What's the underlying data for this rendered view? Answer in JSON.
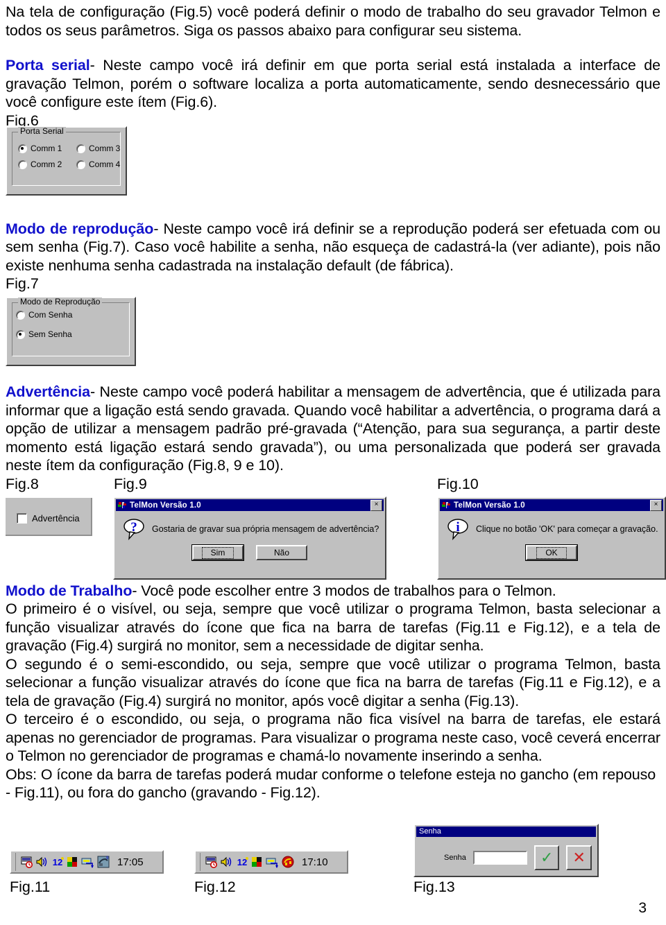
{
  "document": {
    "page_number": "3",
    "intro": "Na tela de configuração (Fig.5) você poderá definir o modo de trabalho do seu gravador Telmon e todos os seus parâmetros. Siga os passos abaixo para configurar seu sistema."
  },
  "sections": {
    "porta_serial": {
      "heading": "Porta serial",
      "body": "- Neste campo você irá definir em que porta serial está instalada a interface de gravação Telmon, porém o software localiza a porta automaticamente, sendo desnecessário que você configure este ítem (Fig.6).",
      "fig_label": "Fig.6"
    },
    "modo_reproducao": {
      "heading": "Modo de reprodução",
      "body": "- Neste campo você irá definir se a reprodução poderá ser efetuada com ou sem senha (Fig.7). Caso você habilite a senha, não esqueça de cadastrá-la (ver adiante), pois não existe nenhuma senha cadastrada na instalação default (de fábrica).",
      "fig_label": "Fig.7"
    },
    "advertencia": {
      "heading": "Advertência",
      "body": "- Neste campo você poderá habilitar a mensagem de advertência, que é utilizada para informar que a ligação está sendo gravada. Quando você habilitar a advertência, o programa dará a opção de utilizar a mensagem padrão pré-gravada (“Atenção, para sua segurança, a partir deste momento está ligação estará sendo gravada”), ou uma personalizada que poderá ser gravada neste ítem da configuração (Fig.8, 9 e 10).",
      "fig_label_8": "Fig.8",
      "fig_label_9": "Fig.9",
      "fig_label_10": "Fig.10"
    },
    "modo_trabalho": {
      "heading": "Modo de Trabalho",
      "body_intro": "- Você pode escolher entre 3 modos de trabalhos para o Telmon.",
      "paragraph_1": "O primeiro é o visível, ou seja, sempre que você utilizar o programa Telmon, basta selecionar a função visualizar através do ícone que fica na barra de tarefas (Fig.11 e Fig.12), e a tela de gravação (Fig.4) surgirá no monitor, sem a necessidade de digitar senha.",
      "paragraph_2": "O segundo é o semi-escondido, ou seja, sempre que você utilizar o programa Telmon, basta selecionar a função visualizar através do ícone que fica na barra de tarefas (Fig.11 e Fig.12), e a tela de gravação (Fig.4) surgirá no monitor, após você digitar a senha (Fig.13).",
      "paragraph_3": "O terceiro é o escondido, ou seja, o programa não fica visível na barra de tarefas, ele estará apenas no gerenciador de programas. Para visualizar o programa neste caso, você ceverá encerrar o Telmon no gerenciador de programas e chamá-lo novamente inserindo a senha.",
      "paragraph_4": "Obs: O ícone da barra de tarefas poderá mudar conforme o telefone esteja no gancho (em repouso - Fig.11), ou fora do gancho (gravando - Fig.12).",
      "fig_label_11": "Fig.11",
      "fig_label_12": "Fig.12",
      "fig_label_13": "Fig.13"
    }
  },
  "figures": {
    "fig6": {
      "group_title": "Porta Serial",
      "options": [
        {
          "label": "Comm 1",
          "selected": true
        },
        {
          "label": "Comm 3",
          "selected": false
        },
        {
          "label": "Comm 2",
          "selected": false
        },
        {
          "label": "Comm 4",
          "selected": false
        }
      ]
    },
    "fig7": {
      "group_title": "Modo de Reprodução",
      "options": [
        {
          "label": "Com Senha",
          "selected": false
        },
        {
          "label": "Sem Senha",
          "selected": true
        }
      ]
    },
    "fig8": {
      "checkbox_label": "Advertência",
      "checked": false
    },
    "fig9": {
      "title": "TelMon Versão 1.0",
      "close_label": "×",
      "icon": "question-icon",
      "message": "Gostaria de gravar sua própria mensagem de advertência?",
      "button_yes": "Sim",
      "button_no": "Não"
    },
    "fig10": {
      "title": "TelMon Versão 1.0",
      "close_label": "×",
      "icon": "info-icon",
      "message": "Clique no botão 'OK' para começar a gravação.",
      "button_ok": "OK"
    },
    "fig11": {
      "clock": "17:05",
      "icons": [
        "display-icon",
        "volume-icon",
        "norton-12-icon",
        "color-palette-icon",
        "modem-icon",
        "telmon-idle-icon"
      ]
    },
    "fig12": {
      "clock": "17:10",
      "icons": [
        "display-icon",
        "volume-icon",
        "norton-12-icon",
        "color-palette-icon",
        "modem-icon",
        "telmon-recording-icon"
      ]
    },
    "fig13": {
      "title": "Senha",
      "field_label": "Senha",
      "field_value": "",
      "ok_glyph": "✓",
      "cancel_glyph": "✕"
    }
  },
  "colors": {
    "heading": "#1111cc",
    "body_text": "#000000",
    "win_face": "#c0c0c0",
    "win_titlebar": "#000080",
    "ok_green": "#2f9e44",
    "cancel_red": "#cc2222"
  }
}
